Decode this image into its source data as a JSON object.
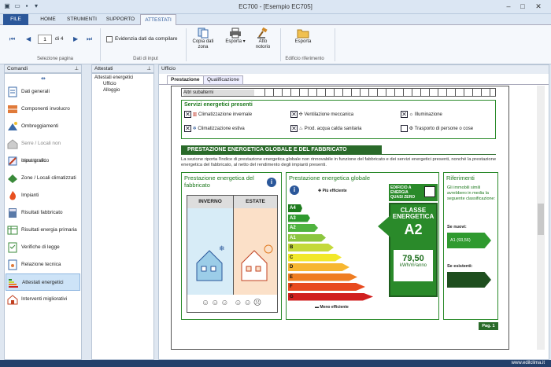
{
  "window": {
    "title": "EC700 - [Esempio EC705]"
  },
  "tabs": [
    "FILE",
    "HOME",
    "STRUMENTI",
    "SUPPORTO",
    "ATTESTATI"
  ],
  "ribbon": {
    "page_value": "1",
    "page_of": "di 4",
    "group_nav": "Selezione pagina",
    "highlight_label": "Evidenzia dati da compilare",
    "group_input": "Dati di input",
    "copy_label": "Copia dati zona",
    "export_label": "Esporta",
    "notary_label": "Atto notorio",
    "export2_label": "Esporta",
    "group_edifice": "Edificio riferimento"
  },
  "left_panel": {
    "title": "Comandi",
    "items": [
      "Dati generali",
      "Componenti involucro",
      "Ombreggiamenti",
      "Serre / Locali non climatizzati",
      "Input grafico",
      "Zone / Locali climatizzati",
      "Impianti",
      "Risultati fabbricato",
      "Risultati energia primaria",
      "Verifiche di legge",
      "Relazione tecnica",
      "Attestati energetici",
      "Interventi migliorativi"
    ]
  },
  "mid_panel": {
    "title": "Attestati",
    "tree_root": "Attestati energetici",
    "tree_items": [
      "Ufficio",
      "Alloggio"
    ]
  },
  "right_panel": {
    "title": "Ufficio",
    "subtabs": [
      "Prestazione",
      "Qualificazione"
    ]
  },
  "doc": {
    "altri": "Altri subalterni",
    "servizi_title": "Servizi energetici presenti",
    "servizi": [
      "Climatizzazione invernale",
      "Ventilazione meccanica",
      "Illuminazione",
      "Climatizzazione estiva",
      "Prod. acqua calda sanitaria",
      "Trasporto di persone o cose"
    ],
    "section_title": "PRESTAZIONE ENERGETICA GLOBALE  E DEL FABBRICATO",
    "section_text": "La sezione riporta l'indice di prestazione energetica globale non rinnovabile in funzione del fabbricato e dei servizi energetici presenti, nonché la prestazione energetica del fabbricato, al netto del rendimento degli impianti presenti.",
    "fabbricato_title": "Prestazione energetica del fabbricato",
    "inverno": "INVERNO",
    "estate": "ESTATE",
    "globale_title": "Prestazione energetica globale",
    "piu_efficiente": "Più efficiente",
    "meno_efficiente": "Meno efficiente",
    "nzeb": "EDIFICIO A ENERGIA QUASI ZERO",
    "classe_label": "CLASSE ENERGETICA",
    "classe_value": "A2",
    "ep_value": "79,50",
    "ep_unit": "kWh/m²anno",
    "classes": [
      "A4",
      "A3",
      "A2",
      "A1",
      "B",
      "C",
      "D",
      "E",
      "F",
      "G"
    ],
    "riferimenti_title": "Riferimenti",
    "riferimenti_text": "Gli immobili simili avrebbero in media la seguente classificazione:",
    "nuovi_label": "Se nuovi:",
    "nuovi_value": "A1  (93,56)",
    "esistenti_label": "Se esistenti:",
    "page": "Pag. 1"
  },
  "status": "www.edilclima.it",
  "colors": {
    "accent": "#2b579a",
    "green": "#2a8a2a",
    "class_colors": [
      "#1e7b1e",
      "#2f9a2f",
      "#4fb33f",
      "#8cc63f",
      "#c4d93a",
      "#f2e82a",
      "#f7b731",
      "#ef7d22",
      "#e84a1f",
      "#d11f1f"
    ]
  }
}
